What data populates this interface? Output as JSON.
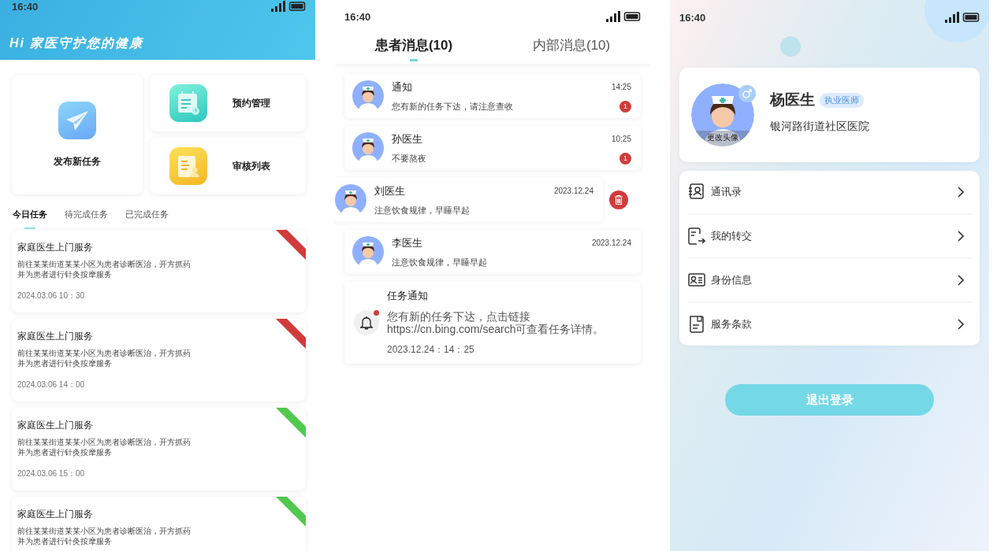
{
  "home": {
    "status_time": "16:40",
    "banner_title": "Hi 家医守护您的健康",
    "shortcuts": [
      {
        "kind": "publish",
        "label": "发布新任务"
      },
      {
        "kind": "appointment",
        "label": "预约管理"
      },
      {
        "kind": "review",
        "label": "审核列表"
      }
    ],
    "tabs": [
      {
        "label": "今日任务",
        "selected": true
      },
      {
        "label": "待完成任务",
        "selected": false
      },
      {
        "label": "已完成任务",
        "selected": false
      }
    ],
    "tasks": [
      {
        "title": "家庭医生上门服务",
        "lines": [
          "前往某某街道某某小区为患者诊断医治，开方抓药",
          "并为患者进行针灸按摩服务"
        ],
        "time": "2024.03.06 10：30",
        "color": "#d13b3b"
      },
      {
        "title": "家庭医生上门服务",
        "lines": [
          "前往某某街道某某小区为患者诊断医治，开方抓药",
          "并为患者进行针灸按摩服务"
        ],
        "time": "2024.03.06 14：00",
        "color": "#d13b3b"
      },
      {
        "title": "家庭医生上门服务",
        "lines": [
          "前往某某街道某某小区为患者诊断医治，开方抓药",
          "并为患者进行针灸按摩服务"
        ],
        "time": "2024.03.06 15：00",
        "color": "#52c84e"
      },
      {
        "title": "家庭医生上门服务",
        "lines": [
          "前往某某街道某某小区为患者诊断医治，开方抓药",
          "并为患者进行针灸按摩服务"
        ],
        "color": "#52c84e"
      }
    ]
  },
  "messages": {
    "status_time": "16:40",
    "tabs": [
      {
        "label": "患者消息(10)",
        "selected": true
      },
      {
        "label": "内部消息(10)",
        "selected": false
      }
    ],
    "items": [
      {
        "kind": "chat",
        "name": "通知",
        "preview": "您有新的任务下达，请注意查收",
        "time": "14:25",
        "badge": "1",
        "swiped": false
      },
      {
        "kind": "chat",
        "name": "孙医生",
        "preview": "不要熬夜",
        "time": "10:25",
        "badge": "1",
        "swiped": false
      },
      {
        "kind": "chat",
        "name": "刘医生",
        "preview": "注意饮食规律，早睡早起",
        "time": "2023.12.24",
        "swiped": true
      },
      {
        "kind": "chat",
        "name": "李医生",
        "preview": "注意饮食规律，早睡早起",
        "time": "2023.12.24",
        "swiped": false
      },
      {
        "kind": "notice",
        "title": "任务通知",
        "lines": [
          "您有新的任务下达，点击链接",
          "https://cn.bing.com/search可查看任务详情。"
        ],
        "time": "2023.12.24：14：25",
        "unread": true
      }
    ]
  },
  "profile": {
    "status_time": "16:40",
    "name": "杨医生",
    "role_badge": "执业医师",
    "hospital": "银河路街道社区医院",
    "avatar_caption": "更改头像",
    "gender_male": true,
    "menu": [
      {
        "kind": "contacts",
        "label": "通讯录"
      },
      {
        "kind": "transfer",
        "label": "我的转交"
      },
      {
        "kind": "identity",
        "label": "身份信息"
      },
      {
        "kind": "terms",
        "label": "服务条款"
      }
    ],
    "logout_label": "退出登录"
  }
}
